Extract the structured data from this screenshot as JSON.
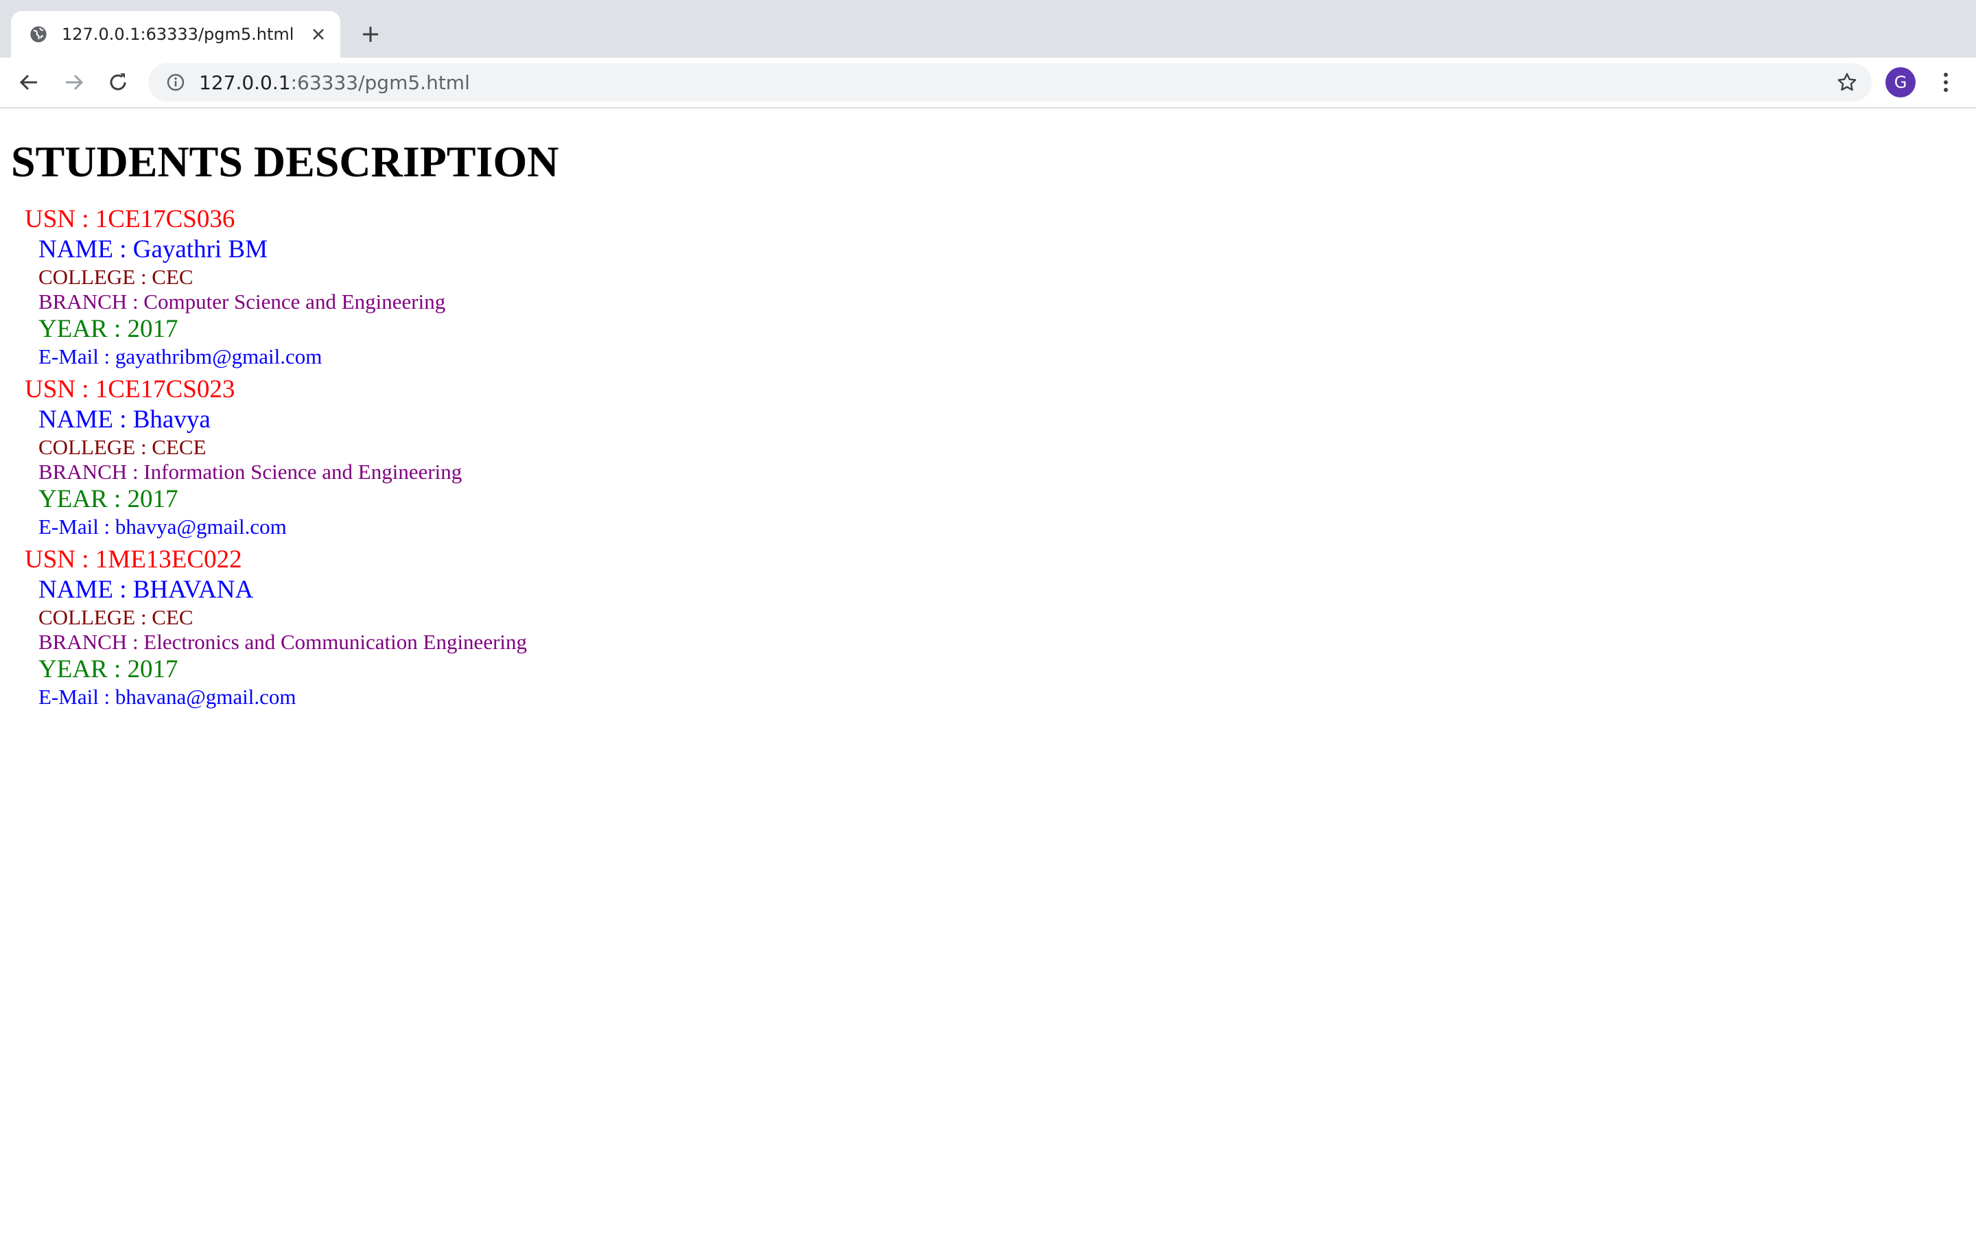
{
  "browser": {
    "tab_title": "127.0.0.1:63333/pgm5.html",
    "url_host": "127.0.0.1",
    "url_path": ":63333/pgm5.html",
    "profile_initial": "G",
    "profile_color": "#5e35b1"
  },
  "page": {
    "title": "STUDENTS DESCRIPTION",
    "students": [
      {
        "usn": "USN : 1CE17CS036",
        "name": "NAME : Gayathri BM",
        "college": "COLLEGE : CEC",
        "branch": "BRANCH : Computer Science and Engineering",
        "year": "YEAR : 2017",
        "email": "E-Mail : gayathribm@gmail.com"
      },
      {
        "usn": "USN : 1CE17CS023",
        "name": "NAME : Bhavya",
        "college": "COLLEGE : CECE",
        "branch": "BRANCH : Information Science and Engineering",
        "year": "YEAR : 2017",
        "email": "E-Mail : bhavya@gmail.com"
      },
      {
        "usn": "USN : 1ME13EC022",
        "name": "NAME : BHAVANA",
        "college": "COLLEGE : CEC",
        "branch": "BRANCH : Electronics and Communication Engineering",
        "year": "YEAR : 2017",
        "email": "E-Mail : bhavana@gmail.com"
      }
    ]
  },
  "colors": {
    "usn": "#ff0000",
    "name": "#0000ff",
    "college": "#800000",
    "branch": "#800080",
    "year": "#008000",
    "email": "#0000ff"
  },
  "icons": [
    "globe-icon",
    "close-icon",
    "plus-icon",
    "back-arrow-icon",
    "forward-arrow-icon",
    "reload-icon",
    "info-icon",
    "star-icon",
    "more-vert-icon"
  ]
}
